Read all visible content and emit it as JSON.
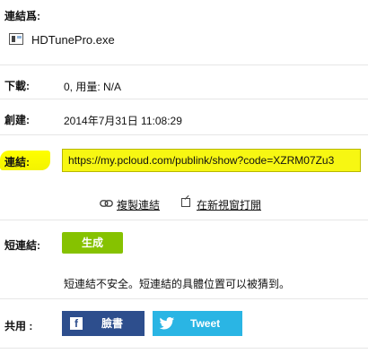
{
  "link_name": {
    "label": "連結爲:",
    "filename": "HDTunePro.exe"
  },
  "downloads": {
    "label": "下載:",
    "value": "0, 用量: N/A"
  },
  "created": {
    "label": "創建:",
    "value": "2014年7月31日 11:08:29"
  },
  "link": {
    "label": "連結:",
    "url": "https://my.pcloud.com/publink/show?code=XZRM07Zu3"
  },
  "actions": {
    "copy_label": "複製連結",
    "open_label": "在新視窗打開"
  },
  "short_link": {
    "label": "短連結:",
    "generate_label": "生成",
    "warning": "短連結不安全。短連結的具體位置可以被猜到。"
  },
  "share": {
    "label": "共用 :",
    "facebook_label": "臉書",
    "twitter_label": "Tweet"
  },
  "colors": {
    "highlight": "#ffff00",
    "generate": "#86c200",
    "facebook": "#2d4e8d",
    "twitter": "#2ab5e4"
  },
  "icons": {
    "file": "file-icon",
    "link": "link-icon",
    "open": "open-new-window-icon",
    "facebook": "facebook-icon",
    "twitter": "twitter-icon"
  }
}
